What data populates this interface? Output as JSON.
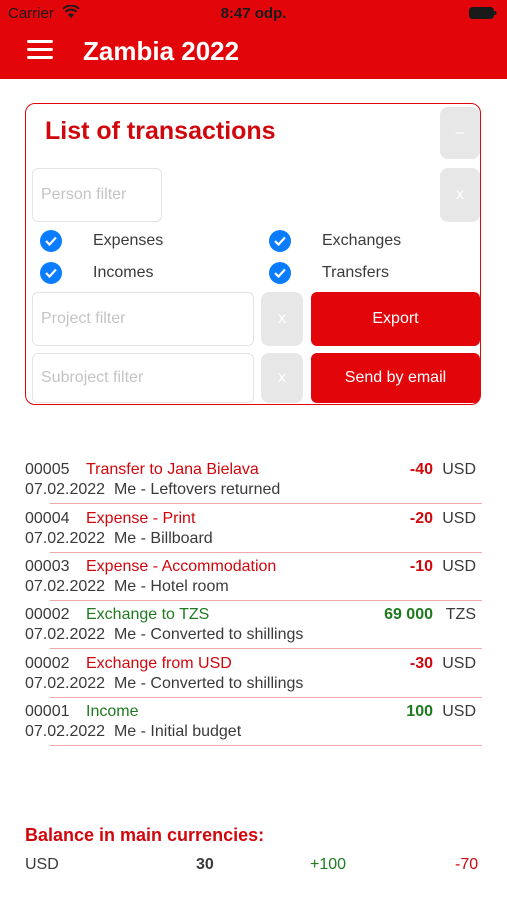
{
  "status_bar": {
    "carrier": "Carrier",
    "time": "8:47 odp."
  },
  "header": {
    "title": "Zambia 2022",
    "menu_icon": "hamburger-menu-icon"
  },
  "filter_panel": {
    "title": "List of transactions",
    "collapse_label": "–",
    "person_filter_placeholder": "Person filter",
    "person_clear_label": "x",
    "checkboxes": [
      {
        "label": "Expenses",
        "checked": true
      },
      {
        "label": "Exchanges",
        "checked": true
      },
      {
        "label": "Incomes",
        "checked": true
      },
      {
        "label": "Transfers",
        "checked": true
      }
    ],
    "project_filter_placeholder": "Project filter",
    "project_clear_label": "x",
    "export_label": "Export",
    "subproject_filter_placeholder": "Subroject filter",
    "subproject_clear_label": "x",
    "email_label": "Send by email",
    "accent_color": "#e2060b"
  },
  "transactions": [
    {
      "number": "00005",
      "description": "Transfer to Jana Bielava",
      "description_color": "red",
      "date": "07.02.2022",
      "detail": "Me - Leftovers returned",
      "amount": "-40",
      "amount_color": "red",
      "currency": "USD"
    },
    {
      "number": "00004",
      "description": "Expense - Print",
      "description_color": "red",
      "date": "07.02.2022",
      "detail": "Me - Billboard",
      "amount": "-20",
      "amount_color": "red",
      "currency": "USD"
    },
    {
      "number": "00003",
      "description": "Expense - Accommodation",
      "description_color": "red",
      "date": "07.02.2022",
      "detail": "Me - Hotel room",
      "amount": "-10",
      "amount_color": "red",
      "currency": "USD"
    },
    {
      "number": "00002",
      "description": "Exchange to TZS",
      "description_color": "green",
      "date": "07.02.2022",
      "detail": "Me - Converted to shillings",
      "amount": "69 000",
      "amount_color": "green",
      "currency": "TZS"
    },
    {
      "number": "00002",
      "description": "Exchange from USD",
      "description_color": "red",
      "date": "07.02.2022",
      "detail": "Me - Converted to shillings",
      "amount": "-30",
      "amount_color": "red",
      "currency": "USD"
    },
    {
      "number": "00001",
      "description": "Income",
      "description_color": "green",
      "date": "07.02.2022",
      "detail": "Me - Initial budget",
      "amount": "100",
      "amount_color": "green",
      "currency": "USD"
    }
  ],
  "balance": {
    "title": "Balance in main currencies:",
    "rows": [
      {
        "currency": "USD",
        "total": "30",
        "income": "+100",
        "expense": "-70"
      }
    ]
  }
}
